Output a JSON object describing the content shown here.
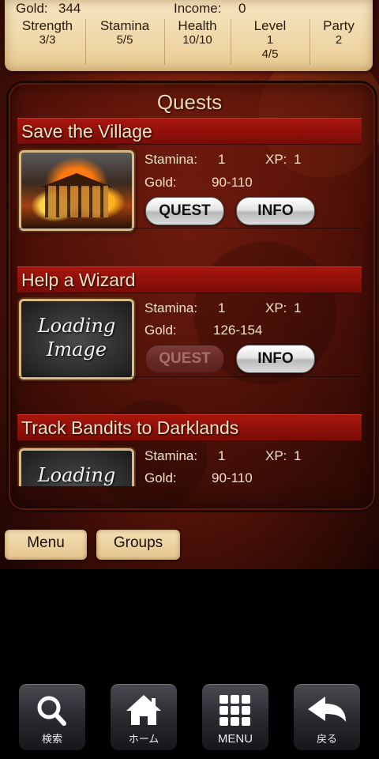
{
  "top": {
    "gold_label": "Gold:",
    "gold_value": "344",
    "income_label": "Income:",
    "income_value": "0"
  },
  "stats": [
    {
      "label": "Strength",
      "value": "3/3",
      "value2": ""
    },
    {
      "label": "Stamina",
      "value": "5/5",
      "value2": ""
    },
    {
      "label": "Health",
      "value": "10/10",
      "value2": ""
    },
    {
      "label": "Level",
      "value": "1",
      "value2": "4/5"
    },
    {
      "label": "Party",
      "value": "2",
      "value2": ""
    }
  ],
  "quests_title": "Quests",
  "quests": [
    {
      "name": "Save the Village",
      "stamina_label": "Stamina:",
      "stamina": "1",
      "xp_label": "XP:",
      "xp": "1",
      "gold_label": "Gold:",
      "gold": "90-110",
      "quest_btn": "QUEST",
      "info_btn": "INFO",
      "quest_enabled": true
    },
    {
      "name": "Help a Wizard",
      "image_text_1": "Loading",
      "image_text_2": "Image",
      "stamina_label": "Stamina:",
      "stamina": "1",
      "xp_label": "XP:",
      "xp": "1",
      "gold_label": "Gold:",
      "gold": "126-154",
      "quest_btn": "QUEST",
      "info_btn": "INFO",
      "quest_enabled": false
    },
    {
      "name": "Track Bandits to Darklands",
      "image_text_1": "Loading",
      "stamina_label": "Stamina:",
      "stamina": "1",
      "xp_label": "XP:",
      "xp": "1",
      "gold_label": "Gold:",
      "gold": "90-110"
    }
  ],
  "bottom_tabs": {
    "menu": "Menu",
    "groups": "Groups"
  },
  "android_nav": [
    {
      "label": "検索",
      "icon": "search-icon"
    },
    {
      "label": "ホーム",
      "icon": "home-icon"
    },
    {
      "label": "MENU",
      "icon": "menu-grid-icon"
    },
    {
      "label": "戻る",
      "icon": "back-arrow-icon"
    }
  ],
  "colors": {
    "quest_bar": "#a8160e",
    "parchment": "#efd7a7",
    "text_light": "#f2e2c4"
  }
}
